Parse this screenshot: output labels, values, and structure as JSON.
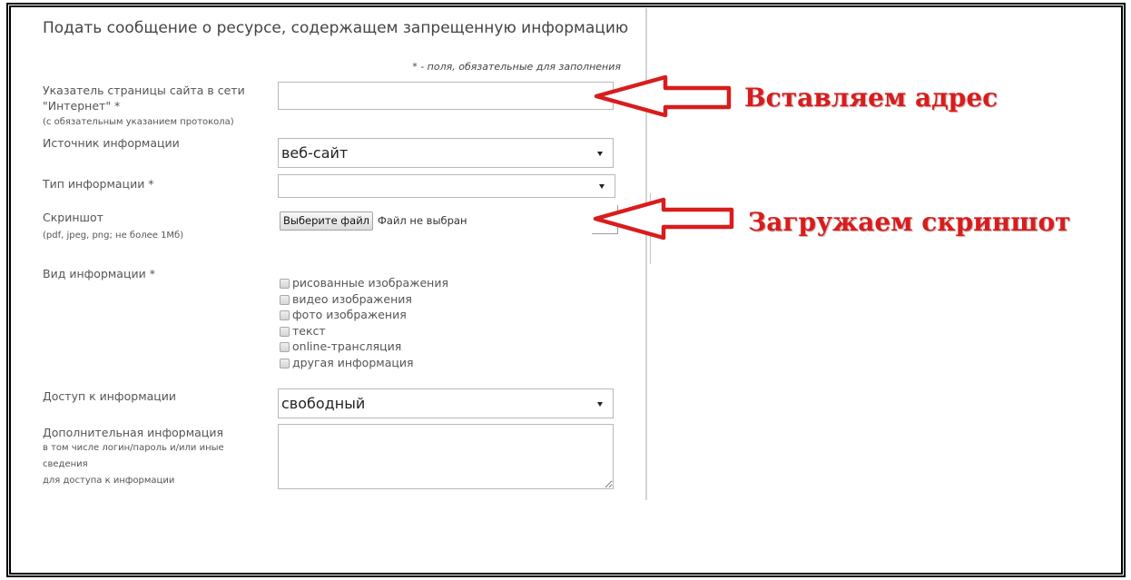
{
  "form": {
    "title": "Подать сообщение о ресурсе, содержащем запрещенную информацию",
    "required_note": "* - поля, обязательные для заполнения",
    "url": {
      "label_line1": "Указатель страницы сайта в сети",
      "label_line2": "\"Интернет\" *",
      "hint": "(с обязательным указанием протокола)",
      "value": ""
    },
    "source": {
      "label": "Источник информации",
      "selected": "веб-сайт"
    },
    "info_type": {
      "label": "Тип информации *",
      "selected": ""
    },
    "screenshot": {
      "label": "Скриншот",
      "hint": "(pdf, jpeg, png; не более 1Мб)",
      "button_label": "Выберите файл",
      "file_status": "Файл не выбран"
    },
    "info_kind": {
      "label": "Вид информации *",
      "options": [
        {
          "label": "рисованные изображения",
          "checked": false
        },
        {
          "label": "видео изображения",
          "checked": false
        },
        {
          "label": "фото изображения",
          "checked": false
        },
        {
          "label": "текст",
          "checked": false
        },
        {
          "label": "online-трансляция",
          "checked": false
        },
        {
          "label": "другая информация",
          "checked": false
        }
      ]
    },
    "access": {
      "label": "Доступ к информации",
      "selected": "свободный"
    },
    "additional": {
      "label": "Дополнительная информация",
      "hint_lines": [
        "в том числе логин/пароль и/или иные",
        "сведения",
        "для доступа к информации"
      ],
      "value": ""
    }
  },
  "annotations": [
    {
      "text": "Вставляем адрес",
      "icon": "arrow-left-icon"
    },
    {
      "text": "Загружаем скриншот",
      "icon": "arrow-left-icon"
    }
  ],
  "icons": {
    "select_arrow": "chevron-down-icon"
  },
  "colors": {
    "annotation_red": "#d91c1c",
    "label_text": "#555555",
    "title_text": "#444444",
    "frame": "#000000"
  }
}
